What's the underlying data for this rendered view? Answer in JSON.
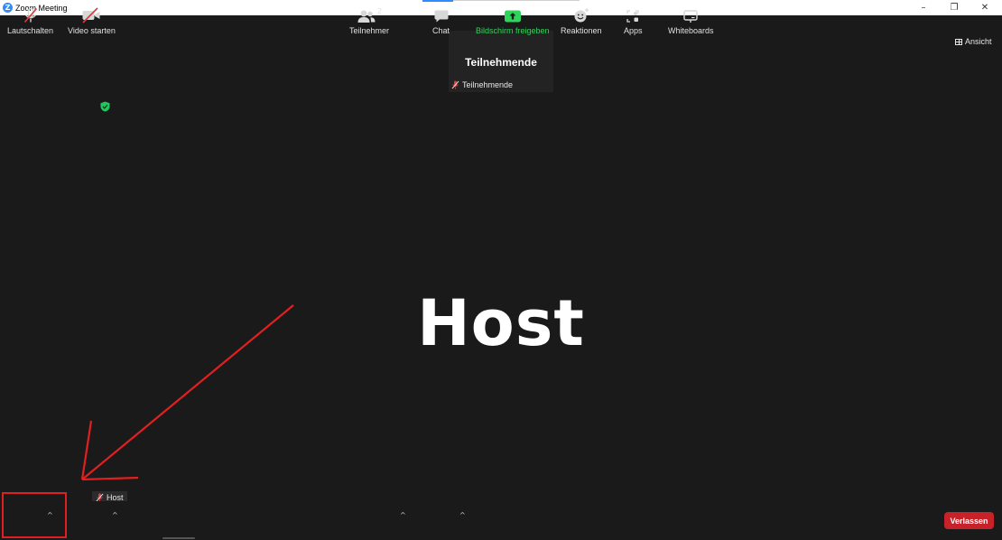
{
  "window": {
    "logo_letter": "Z",
    "title": "Zoom Meeting",
    "minimize_glyph": "–",
    "maximize_glyph": "❐",
    "close_glyph": "✕"
  },
  "view_button": {
    "label": "Ansicht",
    "icon": "grid-icon"
  },
  "thumbnail": {
    "name": "Teilnehmende",
    "footer_label": "Teilnehmende",
    "footer_icon": "muted-mic-icon"
  },
  "security_icon": {
    "icon": "shield-check-icon",
    "color": "#22c55e"
  },
  "active_speaker": {
    "name": "Host"
  },
  "self_view": {
    "name": "Host",
    "icon": "muted-mic-icon"
  },
  "toolbar": {
    "mute_label": "Lautschalten",
    "video_label": "Video starten",
    "participants_label": "Teilnehmer",
    "participants_count": "2",
    "chat_label": "Chat",
    "share_label": "Bildschirm freigeben",
    "reactions_label": "Reaktionen",
    "apps_label": "Apps",
    "whiteboards_label": "Whiteboards",
    "leave_label": "Verlassen",
    "caret_glyph": "^"
  },
  "colors": {
    "background": "#1a1a1a",
    "accent": "#2d8cff",
    "share_green": "#2fd45a",
    "leave_red": "#c7212a",
    "annotation_red": "#e02020"
  }
}
